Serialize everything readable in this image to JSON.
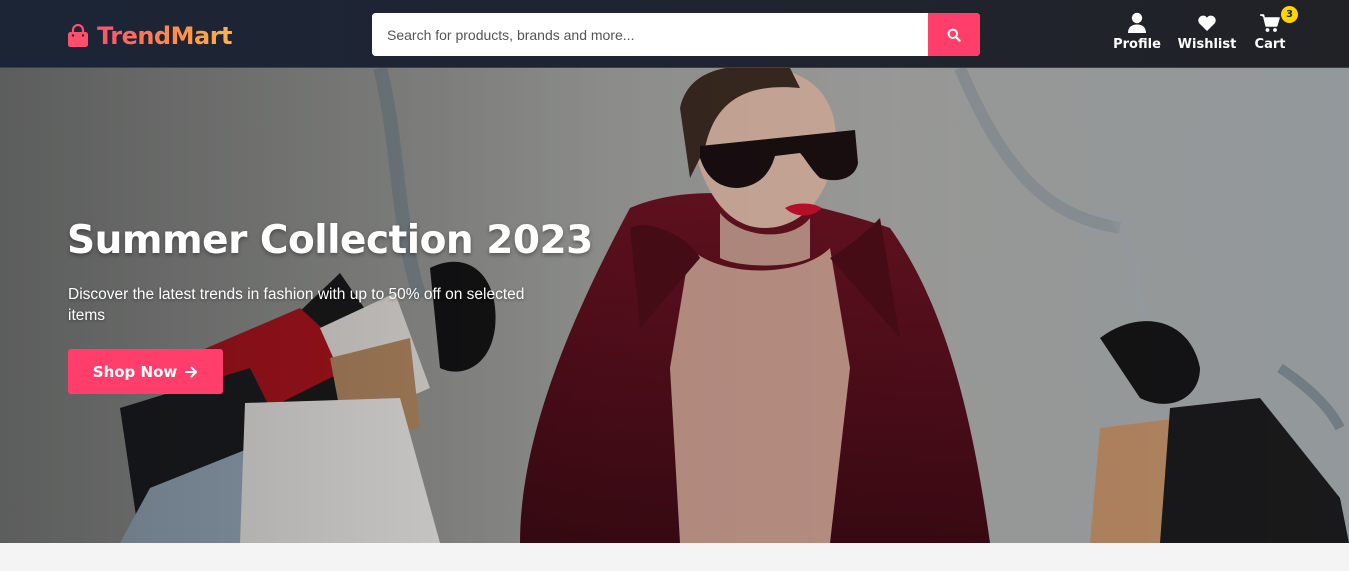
{
  "brand": {
    "name": "TrendMart",
    "logo_icon": "shopping-bag-icon",
    "gradient": [
      "#ff4f6e",
      "#ffb347"
    ]
  },
  "search": {
    "placeholder": "Search for products, brands and more...",
    "value": "",
    "button_icon": "search-icon"
  },
  "nav": {
    "profile": {
      "label": "Profile",
      "icon": "user-icon"
    },
    "wishlist": {
      "label": "Wishlist",
      "icon": "heart-icon"
    },
    "cart": {
      "label": "Cart",
      "icon": "cart-icon",
      "count": "3"
    }
  },
  "hero": {
    "title": "Summer Collection 2023",
    "subtitle": "Discover the latest trends in fashion with up to 50% off on selected items",
    "cta_label": "Shop Now",
    "cta_icon": "arrow-right-icon",
    "image_subject": "woman-with-shopping-bags"
  },
  "colors": {
    "header_bg": "#1f2430",
    "accent": "#ff3e6c",
    "badge": "#ffd400"
  }
}
